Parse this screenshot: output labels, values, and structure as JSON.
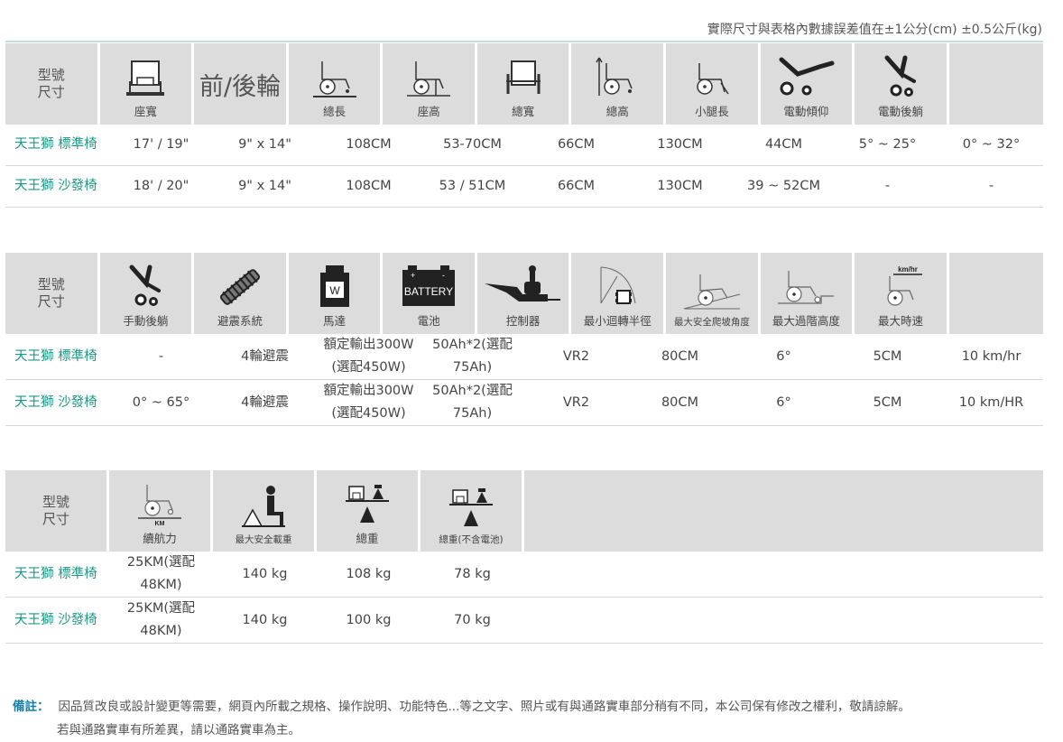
{
  "top_note": "實際尺寸與表格內數據誤差值在±1公分(cm) ±0.5公斤(kg)",
  "tables": [
    {
      "model_label_1": "型號",
      "model_label_2": "尺寸",
      "headers": [
        {
          "label": "座寬",
          "icon": "seat-width-icon"
        },
        {
          "label": "前/後輪",
          "icon": "wheels-text"
        },
        {
          "label": "總長",
          "icon": "total-length-icon"
        },
        {
          "label": "座高",
          "icon": "seat-height-icon"
        },
        {
          "label": "總寬",
          "icon": "total-width-icon"
        },
        {
          "label": "總高",
          "icon": "total-height-icon"
        },
        {
          "label": "小腿長",
          "icon": "leg-length-icon"
        },
        {
          "label": "電動傾仰",
          "icon": "power-tilt-icon"
        },
        {
          "label": "電動後躺",
          "icon": "power-recline-icon"
        }
      ],
      "rows": [
        {
          "model": "天王獅 標準椅",
          "cells": [
            "17' / 19\"",
            "9\" x 14\"",
            "108CM",
            "53-70CM",
            "66CM",
            "130CM",
            "44CM",
            "5° ~ 25°",
            "0° ~ 32°"
          ]
        },
        {
          "model": "天王獅 沙發椅",
          "cells": [
            "18' / 20\"",
            "9\" x 14\"",
            "108CM",
            "53 / 51CM",
            "66CM",
            "130CM",
            "39 ~ 52CM",
            "-",
            "-"
          ]
        }
      ]
    },
    {
      "model_label_1": "型號",
      "model_label_2": "尺寸",
      "headers": [
        {
          "label": "手動後躺",
          "icon": "manual-recline-icon"
        },
        {
          "label": "避震系統",
          "icon": "suspension-icon"
        },
        {
          "label": "馬達",
          "icon": "motor-icon",
          "icon_text": "W"
        },
        {
          "label": "電池",
          "icon": "battery-icon",
          "icon_text": "BATTERY"
        },
        {
          "label": "控制器",
          "icon": "controller-icon"
        },
        {
          "label": "最小迴轉半徑",
          "icon": "turning-radius-icon"
        },
        {
          "label": "最大安全爬坡角度",
          "icon": "slope-icon"
        },
        {
          "label": "最大過階高度",
          "icon": "step-height-icon"
        },
        {
          "label": "最大時速",
          "icon": "speed-icon",
          "icon_text": "km/hr"
        }
      ],
      "rows": [
        {
          "model": "天王獅 標準椅",
          "cells": [
            "-",
            "4輪避震",
            "額定輸出300W (選配450W)",
            "50Ah*2(選配 75Ah)",
            "VR2",
            "80CM",
            "6°",
            "5CM",
            "10 km/hr"
          ]
        },
        {
          "model": "天王獅 沙發椅",
          "cells": [
            "0° ~ 65°",
            "4輪避震",
            "額定輸出300W (選配450W)",
            "50Ah*2(選配 75Ah)",
            "VR2",
            "80CM",
            "6°",
            "5CM",
            "10 km/HR"
          ]
        }
      ]
    },
    {
      "model_label_1": "型號",
      "model_label_2": "尺寸",
      "headers": [
        {
          "label": "續航力",
          "icon": "range-icon",
          "icon_text": "KM"
        },
        {
          "label": "最大安全載重",
          "icon": "max-load-icon"
        },
        {
          "label": "總重",
          "icon": "total-weight-icon"
        },
        {
          "label": "總重(不含電池)",
          "icon": "weight-no-battery-icon"
        }
      ],
      "rows": [
        {
          "model": "天王獅 標準椅",
          "cells": [
            "25KM(選配 48KM)",
            "140 kg",
            "108 kg",
            "78 kg"
          ]
        },
        {
          "model": "天王獅 沙發椅",
          "cells": [
            "25KM(選配 48KM)",
            "140 kg",
            "100 kg",
            "70 kg"
          ]
        }
      ]
    }
  ],
  "remarks": {
    "label": "備註：",
    "line1": "因品質改良或設計變更等需要，網頁內所載之規格、操作說明、功能特色...等之文字、照片或有與通路實車部分稍有不同，本公司保有修改之權利，敬請諒解。",
    "line2": "若與通路實車有所差異，請以通路實車為主。"
  }
}
